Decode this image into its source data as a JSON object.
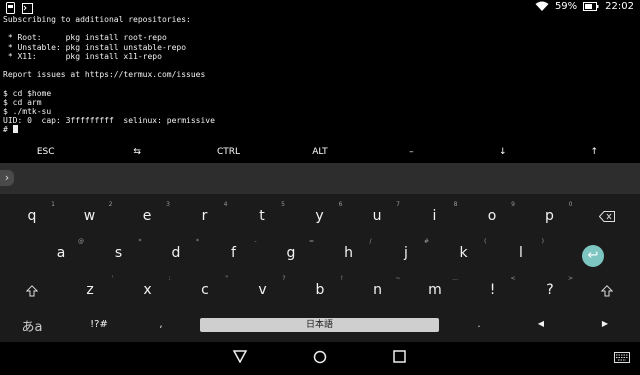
{
  "status": {
    "battery": "59%",
    "time": "22:02"
  },
  "terminal": {
    "lines": [
      "Subscribing to additional repositories:",
      "",
      " * Root:     pkg install root-repo",
      " * Unstable: pkg install unstable-repo",
      " * X11:      pkg install x11-repo",
      "",
      "Report issues at https://termux.com/issues",
      "",
      "$ cd $home",
      "$ cd arm",
      "$ ./mtk-su",
      "UID: 0  cap: 3fffffffff  selinux: permissive"
    ],
    "prompt": "# "
  },
  "extra_keys": [
    "ESC",
    "⇆",
    "CTRL",
    "ALT",
    "–",
    "↓",
    "↑"
  ],
  "keyboard": {
    "row1": [
      {
        "ch": "q",
        "hint": "1"
      },
      {
        "ch": "w",
        "hint": "2"
      },
      {
        "ch": "e",
        "hint": "3"
      },
      {
        "ch": "r",
        "hint": "4"
      },
      {
        "ch": "t",
        "hint": "5"
      },
      {
        "ch": "y",
        "hint": "6"
      },
      {
        "ch": "u",
        "hint": "7"
      },
      {
        "ch": "i",
        "hint": "8"
      },
      {
        "ch": "o",
        "hint": "9"
      },
      {
        "ch": "p",
        "hint": "0"
      }
    ],
    "row2": [
      {
        "ch": "a",
        "hint": "@"
      },
      {
        "ch": "s",
        "hint": "*"
      },
      {
        "ch": "d",
        "hint": "*"
      },
      {
        "ch": "f",
        "hint": "-"
      },
      {
        "ch": "g",
        "hint": "="
      },
      {
        "ch": "h",
        "hint": "/"
      },
      {
        "ch": "j",
        "hint": "#"
      },
      {
        "ch": "k",
        "hint": "("
      },
      {
        "ch": "l",
        "hint": ")"
      }
    ],
    "row3": [
      {
        "ch": "z",
        "hint": "'"
      },
      {
        "ch": "x",
        "hint": ":"
      },
      {
        "ch": "c",
        "hint": "\""
      },
      {
        "ch": "v",
        "hint": "?"
      },
      {
        "ch": "b",
        "hint": "!"
      },
      {
        "ch": "n",
        "hint": "~"
      },
      {
        "ch": "m",
        "hint": "..."
      },
      {
        "ch": "!",
        "hint": "<"
      },
      {
        "ch": "?",
        "hint": ">"
      }
    ],
    "row4": {
      "lang_toggle": "あa",
      "symbols": "!?#",
      "comma": ",",
      "space": "日本語",
      "period": ".",
      "left": "◀",
      "right": "▶"
    }
  },
  "colors": {
    "enter_accent": "#7cc5c1",
    "drawer_bg": "#2d2d2d",
    "keyboard_bg": "#1b1b1b"
  },
  "icons": [
    "termux-icon",
    "notification-icon",
    "wifi-icon",
    "battery-icon",
    "backspace-icon",
    "shift-icon",
    "enter-icon",
    "back-icon",
    "home-icon",
    "recents-icon",
    "keyboard-icon"
  ]
}
